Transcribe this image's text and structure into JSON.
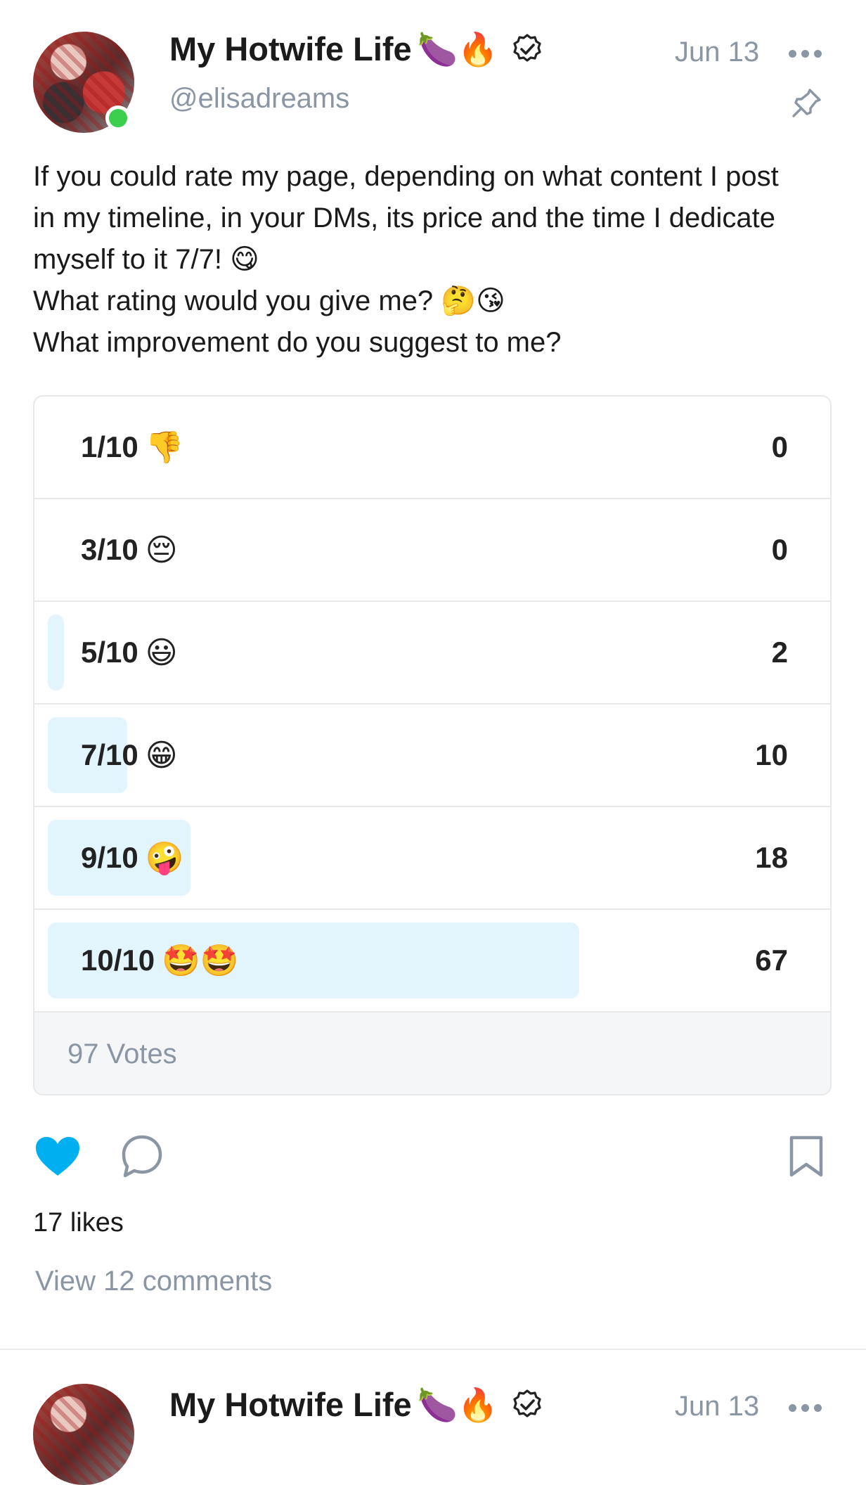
{
  "post": {
    "author_name": "My Hotwife Life",
    "author_emojis": "🍆🔥",
    "handle": "@elisadreams",
    "date": "Jun 13",
    "text_lines": [
      "If you could rate my page, depending on what content I post",
      "in my timeline, in your DMs, its price and the time I dedicate",
      "myself to it 7/7! 😋",
      "What rating would you give me? 🤔😘",
      "What improvement do you suggest to me?"
    ],
    "poll": {
      "options": [
        {
          "label": "1/10",
          "emoji": "👎",
          "count": "0",
          "fraction": 0
        },
        {
          "label": "3/10",
          "emoji": "😔",
          "count": "0",
          "fraction": 0
        },
        {
          "label": "5/10",
          "emoji": "😃",
          "count": "2",
          "fraction": 0.021
        },
        {
          "label": "7/10",
          "emoji": "😁",
          "count": "10",
          "fraction": 0.103
        },
        {
          "label": "9/10",
          "emoji": "🤪",
          "count": "18",
          "fraction": 0.186
        },
        {
          "label": "10/10",
          "emoji": "🤩🤩",
          "count": "67",
          "fraction": 0.691
        }
      ],
      "total_votes": "97 Votes"
    },
    "likes": "17 likes",
    "view_comments": "View 12 comments",
    "icons": {
      "like": "heart-icon",
      "comment": "comment-bubble-icon",
      "bookmark": "bookmark-icon",
      "more": "more-dots-icon",
      "pin": "pin-icon",
      "verified": "verified-badge-icon"
    },
    "colors": {
      "accent": "#00aff0",
      "poll_bar": "#e2f4fc",
      "muted_text": "#8a96a3",
      "online": "#3ccf4e"
    }
  },
  "next_post": {
    "author_name": "My Hotwife Life",
    "author_emojis": "🍆🔥",
    "date": "Jun 13"
  }
}
